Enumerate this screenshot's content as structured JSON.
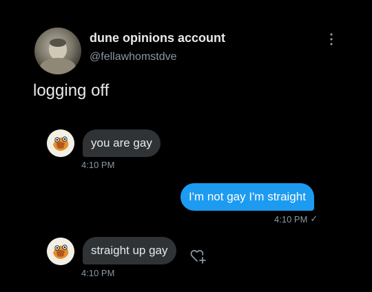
{
  "tweet": {
    "display_name": "dune opinions account",
    "handle": "@fellawhomstdve",
    "text": "logging off"
  },
  "messages": [
    {
      "direction": "incoming",
      "text": "you are gay",
      "time": "4:10 PM"
    },
    {
      "direction": "outgoing",
      "text": "I'm not gay I'm straight",
      "time": "4:10 PM",
      "status": "✓"
    },
    {
      "direction": "incoming",
      "text": "straight up gay",
      "time": "4:10 PM"
    }
  ],
  "icons": {
    "more": "more-vertical-icon",
    "react": "add-reaction-heart-icon"
  },
  "colors": {
    "background": "#000000",
    "incoming_bubble": "#2f3336",
    "outgoing_bubble": "#1d9bf0",
    "secondary_text": "#8b98a5"
  }
}
